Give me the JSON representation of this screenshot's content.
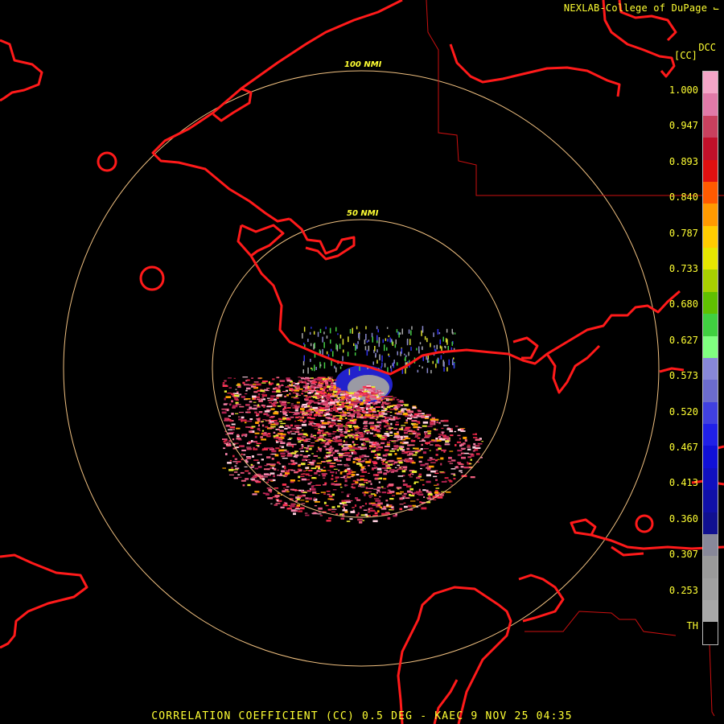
{
  "header": {
    "credit": "NEXLAB-College of DuPage",
    "logo_icon": "cod-logo-icon",
    "product_code": "DCC",
    "units": "[CC]"
  },
  "rings": [
    {
      "label": "100 NMI"
    },
    {
      "label": "50 NMI"
    }
  ],
  "legend": {
    "ticks": [
      "1.000",
      "0.947",
      "0.893",
      "0.840",
      "0.787",
      "0.733",
      "0.680",
      "0.627",
      "0.573",
      "0.520",
      "0.467",
      "0.413",
      "0.360",
      "0.307",
      "0.253",
      "TH"
    ],
    "colors": [
      "#f4a6c8",
      "#e07aa8",
      "#c8405e",
      "#c0102a",
      "#e01010",
      "#ff5a00",
      "#ff9a00",
      "#ffcc00",
      "#e6e600",
      "#a8d000",
      "#60c000",
      "#40d040",
      "#80ff80",
      "#8888d8",
      "#6c6ccc",
      "#4040e0",
      "#2020e8",
      "#1010d8",
      "#1010c0",
      "#1010a8",
      "#101090",
      "#888899",
      "#9a9a9a",
      "#a0a0a0",
      "#a8a8a8",
      "#000000"
    ]
  },
  "caption": "CORRELATION COEFFICIENT (CC) 0.5 DEG - KAEC 9 NOV 25 04:35",
  "colors": {
    "background": "#000000",
    "coastline": "#ff1a1a",
    "ring": "#f0c080",
    "text": "#ffff33"
  }
}
